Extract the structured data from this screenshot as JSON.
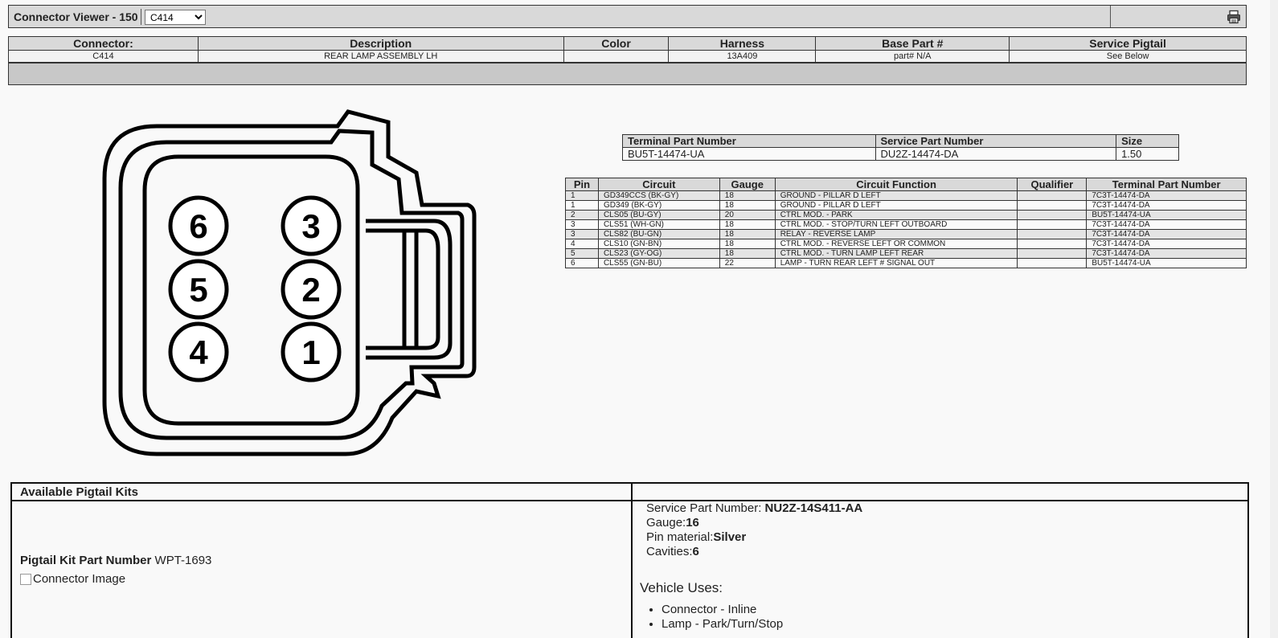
{
  "topbar": {
    "title": "Connector Viewer - 150",
    "selected_connector": "C414"
  },
  "icons": {
    "print": "printer-icon"
  },
  "connector_info": {
    "headers": [
      "Connector:",
      "Description",
      "Color",
      "Harness",
      "Base Part #",
      "Service Pigtail"
    ],
    "row": [
      "C414",
      "REAR LAMP ASSEMBLY LH",
      "",
      "13A409",
      "part# N/A",
      "See Below"
    ]
  },
  "diagram": {
    "pins": [
      "6",
      "3",
      "5",
      "2",
      "4",
      "1"
    ]
  },
  "terminal_table": {
    "headers": [
      "Terminal Part Number",
      "Service Part Number",
      "Size"
    ],
    "row": [
      "BU5T-14474-UA",
      "DU2Z-14474-DA",
      "1.50"
    ]
  },
  "pin_table": {
    "headers": [
      "Pin",
      "Circuit",
      "Gauge",
      "Circuit Function",
      "Qualifier",
      "Terminal Part Number"
    ],
    "rows": [
      [
        "1",
        "GD349CCS (BK-GY)",
        "18",
        "GROUND - PILLAR D LEFT",
        "",
        "7C3T-14474-DA"
      ],
      [
        "1",
        "GD349 (BK-GY)",
        "18",
        "GROUND - PILLAR D LEFT",
        "",
        "7C3T-14474-DA"
      ],
      [
        "2",
        "CLS05 (BU-GY)",
        "20",
        "CTRL MOD. - PARK",
        "",
        "BU5T-14474-UA"
      ],
      [
        "3",
        "CLS51 (WH-GN)",
        "18",
        "CTRL MOD. - STOP/TURN LEFT OUTBOARD",
        "",
        "7C3T-14474-DA"
      ],
      [
        "3",
        "CLS82 (BU-GN)",
        "18",
        "RELAY - REVERSE LAMP",
        "",
        "7C3T-14474-DA"
      ],
      [
        "4",
        "CLS10 (GN-BN)",
        "18",
        "CTRL MOD. - REVERSE LEFT OR COMMON",
        "",
        "7C3T-14474-DA"
      ],
      [
        "5",
        "CLS23 (GY-OG)",
        "18",
        "CTRL MOD. - TURN LAMP LEFT REAR",
        "",
        "7C3T-14474-DA"
      ],
      [
        "6",
        "CLS55 (GN-BU)",
        "22",
        "LAMP - TURN REAR LEFT # SIGNAL OUT",
        "",
        "BU5T-14474-UA"
      ]
    ]
  },
  "pigtail": {
    "header": "Available Pigtail Kits",
    "kit_label": "Pigtail Kit Part Number",
    "kit_number": "WPT-1693",
    "image_alt": "Connector Image",
    "service_part_label": "Service Part Number: ",
    "service_part_value": "NU2Z-14S411-AA",
    "gauge_label": "Gauge:",
    "gauge_value": "16",
    "pin_material_label": "Pin material:",
    "pin_material_value": "Silver",
    "cavities_label": "Cavities:",
    "cavities_value": "6",
    "vehicle_uses_label": "Vehicle Uses:",
    "uses": [
      "Connector - Inline",
      "Lamp - Park/Turn/Stop"
    ]
  }
}
